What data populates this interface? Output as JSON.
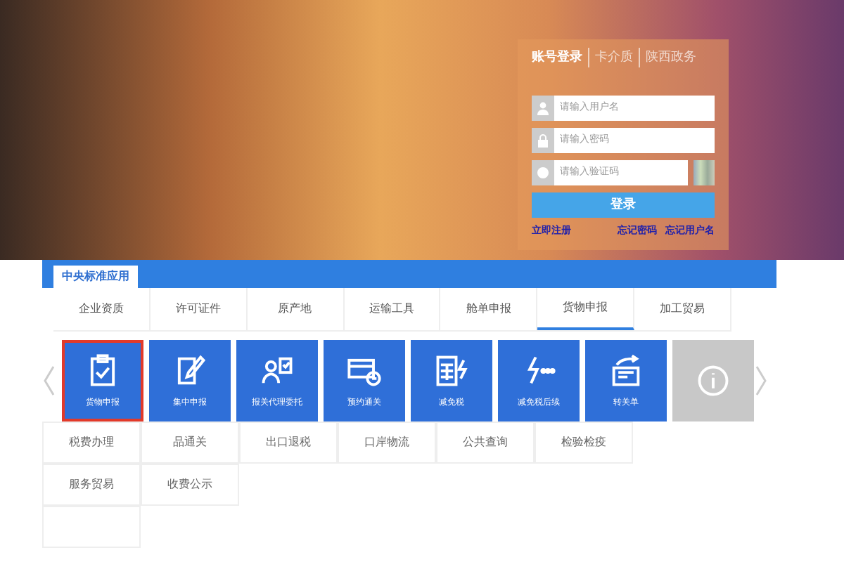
{
  "login": {
    "tabs": [
      {
        "label": "账号登录",
        "selected": true
      },
      {
        "label": "卡介质",
        "selected": false
      },
      {
        "label": "陕西政务",
        "selected": false
      }
    ],
    "fields": [
      {
        "kind": "user",
        "placeholder": "请输入用户名"
      },
      {
        "kind": "lock",
        "placeholder": "请输入密码"
      },
      {
        "kind": "captcha",
        "placeholder": "请输入验证码"
      }
    ],
    "submit": "登录",
    "links": [
      "立即注册",
      "忘记密码",
      "忘记用户名"
    ]
  },
  "section_tab": {
    "label": "中央标准应用",
    "selected": true
  },
  "categories": [
    {
      "label": "企业资质",
      "selected": false
    },
    {
      "label": "许可证件",
      "selected": false
    },
    {
      "label": "原产地",
      "selected": false
    },
    {
      "label": "运输工具",
      "selected": false
    },
    {
      "label": "舱单申报",
      "selected": false
    },
    {
      "label": "货物申报",
      "selected": true
    },
    {
      "label": "加工贸易",
      "selected": false
    }
  ],
  "tiles": [
    {
      "kind": "clipboard",
      "label": "货物申报",
      "selected": true,
      "disabled": false
    },
    {
      "kind": "sign",
      "label": "集中申报",
      "selected": false,
      "disabled": false
    },
    {
      "kind": "people",
      "label": "报关代理委托",
      "selected": false,
      "disabled": false
    },
    {
      "kind": "card",
      "label": "预约通关",
      "selected": false,
      "disabled": false
    },
    {
      "kind": "calc",
      "label": "减免税",
      "selected": false,
      "disabled": false
    },
    {
      "kind": "more",
      "label": "减免税后续",
      "selected": false,
      "disabled": false
    },
    {
      "kind": "transfer",
      "label": "转关单",
      "selected": false,
      "disabled": false
    },
    {
      "kind": "info",
      "selected": false,
      "disabled": true
    }
  ],
  "more_rows": [
    [
      "税费办理",
      "品通关",
      "出口退税",
      "口岸物流",
      "公共查询",
      "检验检疫"
    ],
    [
      "服务贸易",
      "收费公示"
    ]
  ]
}
